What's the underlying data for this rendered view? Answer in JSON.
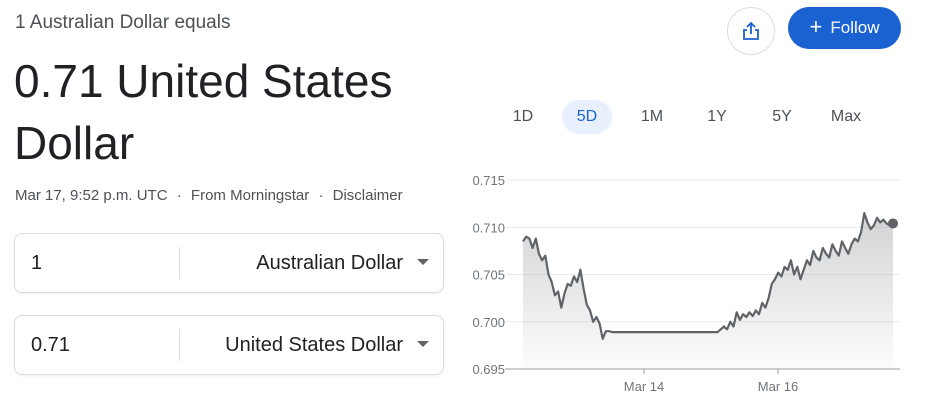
{
  "header": {
    "subtitle": "1 Australian Dollar equals",
    "result": "0.71 United States Dollar",
    "timestamp": "Mar 17, 9:52 p.m. UTC",
    "sep1": "·",
    "source": "From Morningstar",
    "sep2": "·",
    "disclaimer": "Disclaimer"
  },
  "actions": {
    "follow_label": "Follow",
    "follow_plus": "+",
    "accent": "#1a62d1"
  },
  "converter": {
    "from": {
      "amount": "1",
      "currency": "Australian Dollar"
    },
    "to": {
      "amount": "0.71",
      "currency": "United States Dollar"
    }
  },
  "ranges": [
    {
      "label": "1D",
      "active": false
    },
    {
      "label": "5D",
      "active": true
    },
    {
      "label": "1M",
      "active": false
    },
    {
      "label": "1Y",
      "active": false
    },
    {
      "label": "5Y",
      "active": false
    },
    {
      "label": "Max",
      "active": false
    }
  ],
  "chart_data": {
    "type": "area",
    "x_ticks": [
      "Mar 14",
      "Mar 16"
    ],
    "y_ticks": [
      "0.715",
      "0.710",
      "0.705",
      "0.700",
      "0.695"
    ],
    "ylim": [
      0.695,
      0.715
    ],
    "grid": true,
    "line_color": "#5f6368",
    "series": [
      {
        "values": [
          0.7085,
          0.709,
          0.7088,
          0.7078,
          0.7088,
          0.7072,
          0.7065,
          0.707,
          0.705,
          0.7042,
          0.7028,
          0.7032,
          0.7015,
          0.703,
          0.704,
          0.7038,
          0.7048,
          0.7042,
          0.7055,
          0.7035,
          0.7018,
          0.7012,
          0.7,
          0.7005,
          0.6998,
          0.6982,
          0.699,
          0.699,
          0.6989,
          0.6989,
          0.6989,
          0.6989,
          0.6989,
          0.6989,
          0.6989,
          0.6989,
          0.6989,
          0.6989,
          0.6989,
          0.6989,
          0.6989,
          0.6989,
          0.6989,
          0.6989,
          0.6989,
          0.6989,
          0.6989,
          0.6989,
          0.6989,
          0.6989,
          0.6989,
          0.6989,
          0.6989,
          0.6989,
          0.6989,
          0.6989,
          0.6989,
          0.6989,
          0.6989,
          0.6989,
          0.6989,
          0.6989,
          0.6992,
          0.6995,
          0.6992,
          0.7,
          0.6995,
          0.701,
          0.7002,
          0.7008,
          0.7005,
          0.701,
          0.7006,
          0.7012,
          0.7008,
          0.702,
          0.7015,
          0.7025,
          0.704,
          0.7045,
          0.7052,
          0.7048,
          0.7058,
          0.7055,
          0.7065,
          0.705,
          0.7058,
          0.7045,
          0.7055,
          0.7065,
          0.706,
          0.7075,
          0.7068,
          0.7065,
          0.7078,
          0.7072,
          0.7068,
          0.7082,
          0.7075,
          0.707,
          0.7085,
          0.7078,
          0.7072,
          0.7082,
          0.7088,
          0.7085,
          0.7095,
          0.7115,
          0.7105,
          0.7098,
          0.7102,
          0.711,
          0.7105,
          0.7108,
          0.7104,
          0.7102,
          0.7104
        ]
      }
    ]
  }
}
